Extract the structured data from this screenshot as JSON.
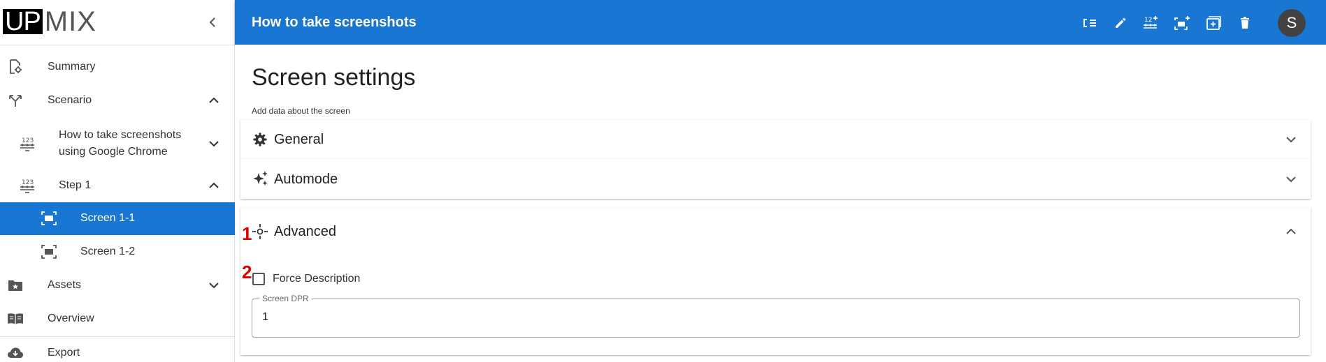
{
  "app": {
    "logo_left": "UP",
    "logo_right": "MIX"
  },
  "header": {
    "title": "How to take screenshots",
    "avatar_letter": "S",
    "actions": [
      "list-icon",
      "edit-icon",
      "add-step-icon",
      "add-screen-icon",
      "duplicate-screen-icon",
      "delete-icon"
    ]
  },
  "sidebar": {
    "summary": "Summary",
    "scenario": "Scenario",
    "scenario_item_line1": "How to take screenshots",
    "scenario_item_line2": "using Google Chrome",
    "step": "Step 1",
    "screen_1": "Screen 1-1",
    "screen_2": "Screen 1-2",
    "assets": "Assets",
    "overview": "Overview",
    "export": "Export"
  },
  "main": {
    "page_title": "Screen settings",
    "page_subtitle": "Add data about the screen",
    "panels": {
      "general": "General",
      "automode": "Automode",
      "advanced": "Advanced"
    },
    "markers": {
      "one": "1",
      "two": "2"
    },
    "force_description_label": "Force Description",
    "force_description_checked": false,
    "screen_dpr_label": "Screen DPR",
    "screen_dpr_value": "1"
  },
  "colors": {
    "primary": "#1976d2",
    "marker": "#e00000"
  }
}
